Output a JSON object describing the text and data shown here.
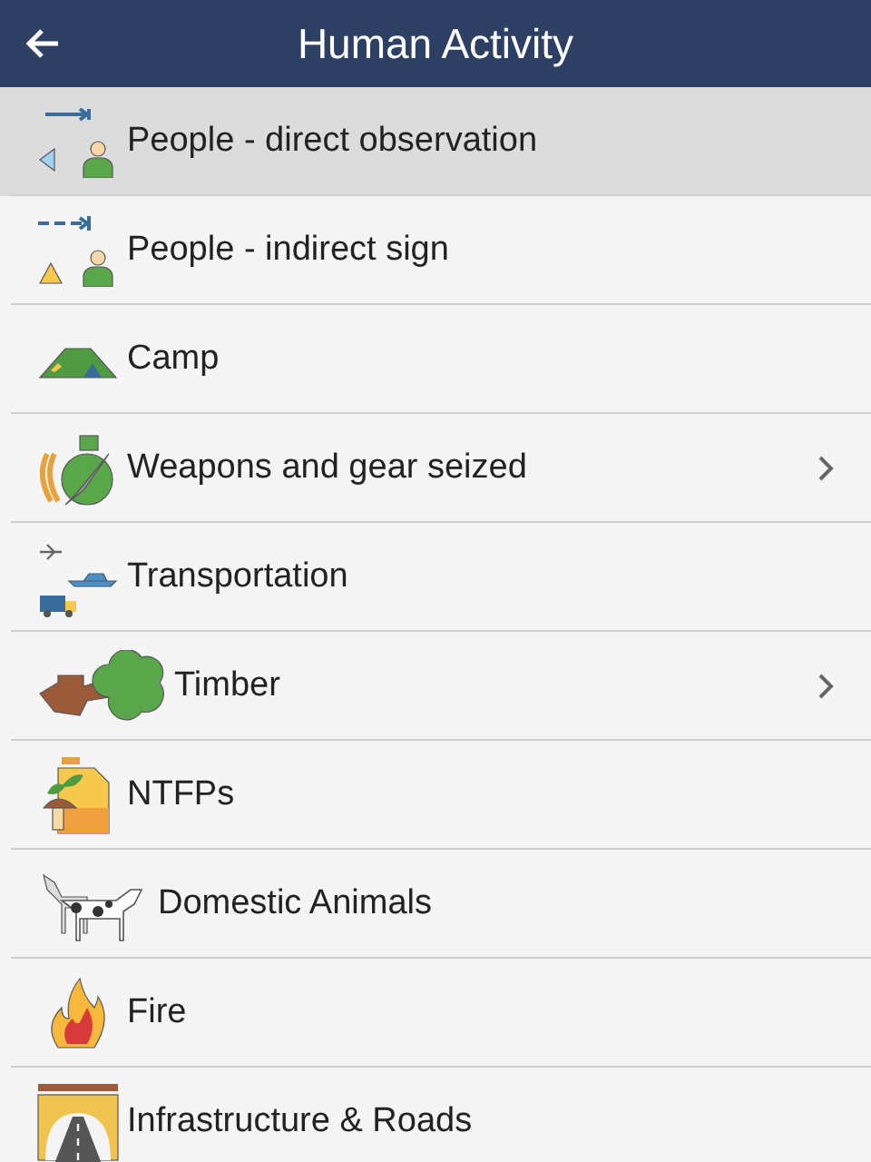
{
  "header": {
    "title": "Human Activity"
  },
  "items": [
    {
      "label": "People - direct observation",
      "kind": "people-direct",
      "selected": true,
      "has_submenu": false
    },
    {
      "label": "People - indirect sign",
      "kind": "people-indirect",
      "selected": false,
      "has_submenu": false
    },
    {
      "label": "Camp",
      "kind": "camp",
      "selected": false,
      "has_submenu": false
    },
    {
      "label": "Weapons and gear seized",
      "kind": "weapons",
      "selected": false,
      "has_submenu": true
    },
    {
      "label": "Transportation",
      "kind": "transport",
      "selected": false,
      "has_submenu": false
    },
    {
      "label": "Timber",
      "kind": "timber",
      "selected": false,
      "has_submenu": true
    },
    {
      "label": "NTFPs",
      "kind": "ntfp",
      "selected": false,
      "has_submenu": false
    },
    {
      "label": "Domestic Animals",
      "kind": "animals",
      "selected": false,
      "has_submenu": false
    },
    {
      "label": "Fire",
      "kind": "fire",
      "selected": false,
      "has_submenu": false
    },
    {
      "label": "Infrastructure & Roads",
      "kind": "roads",
      "selected": false,
      "has_submenu": false
    }
  ]
}
